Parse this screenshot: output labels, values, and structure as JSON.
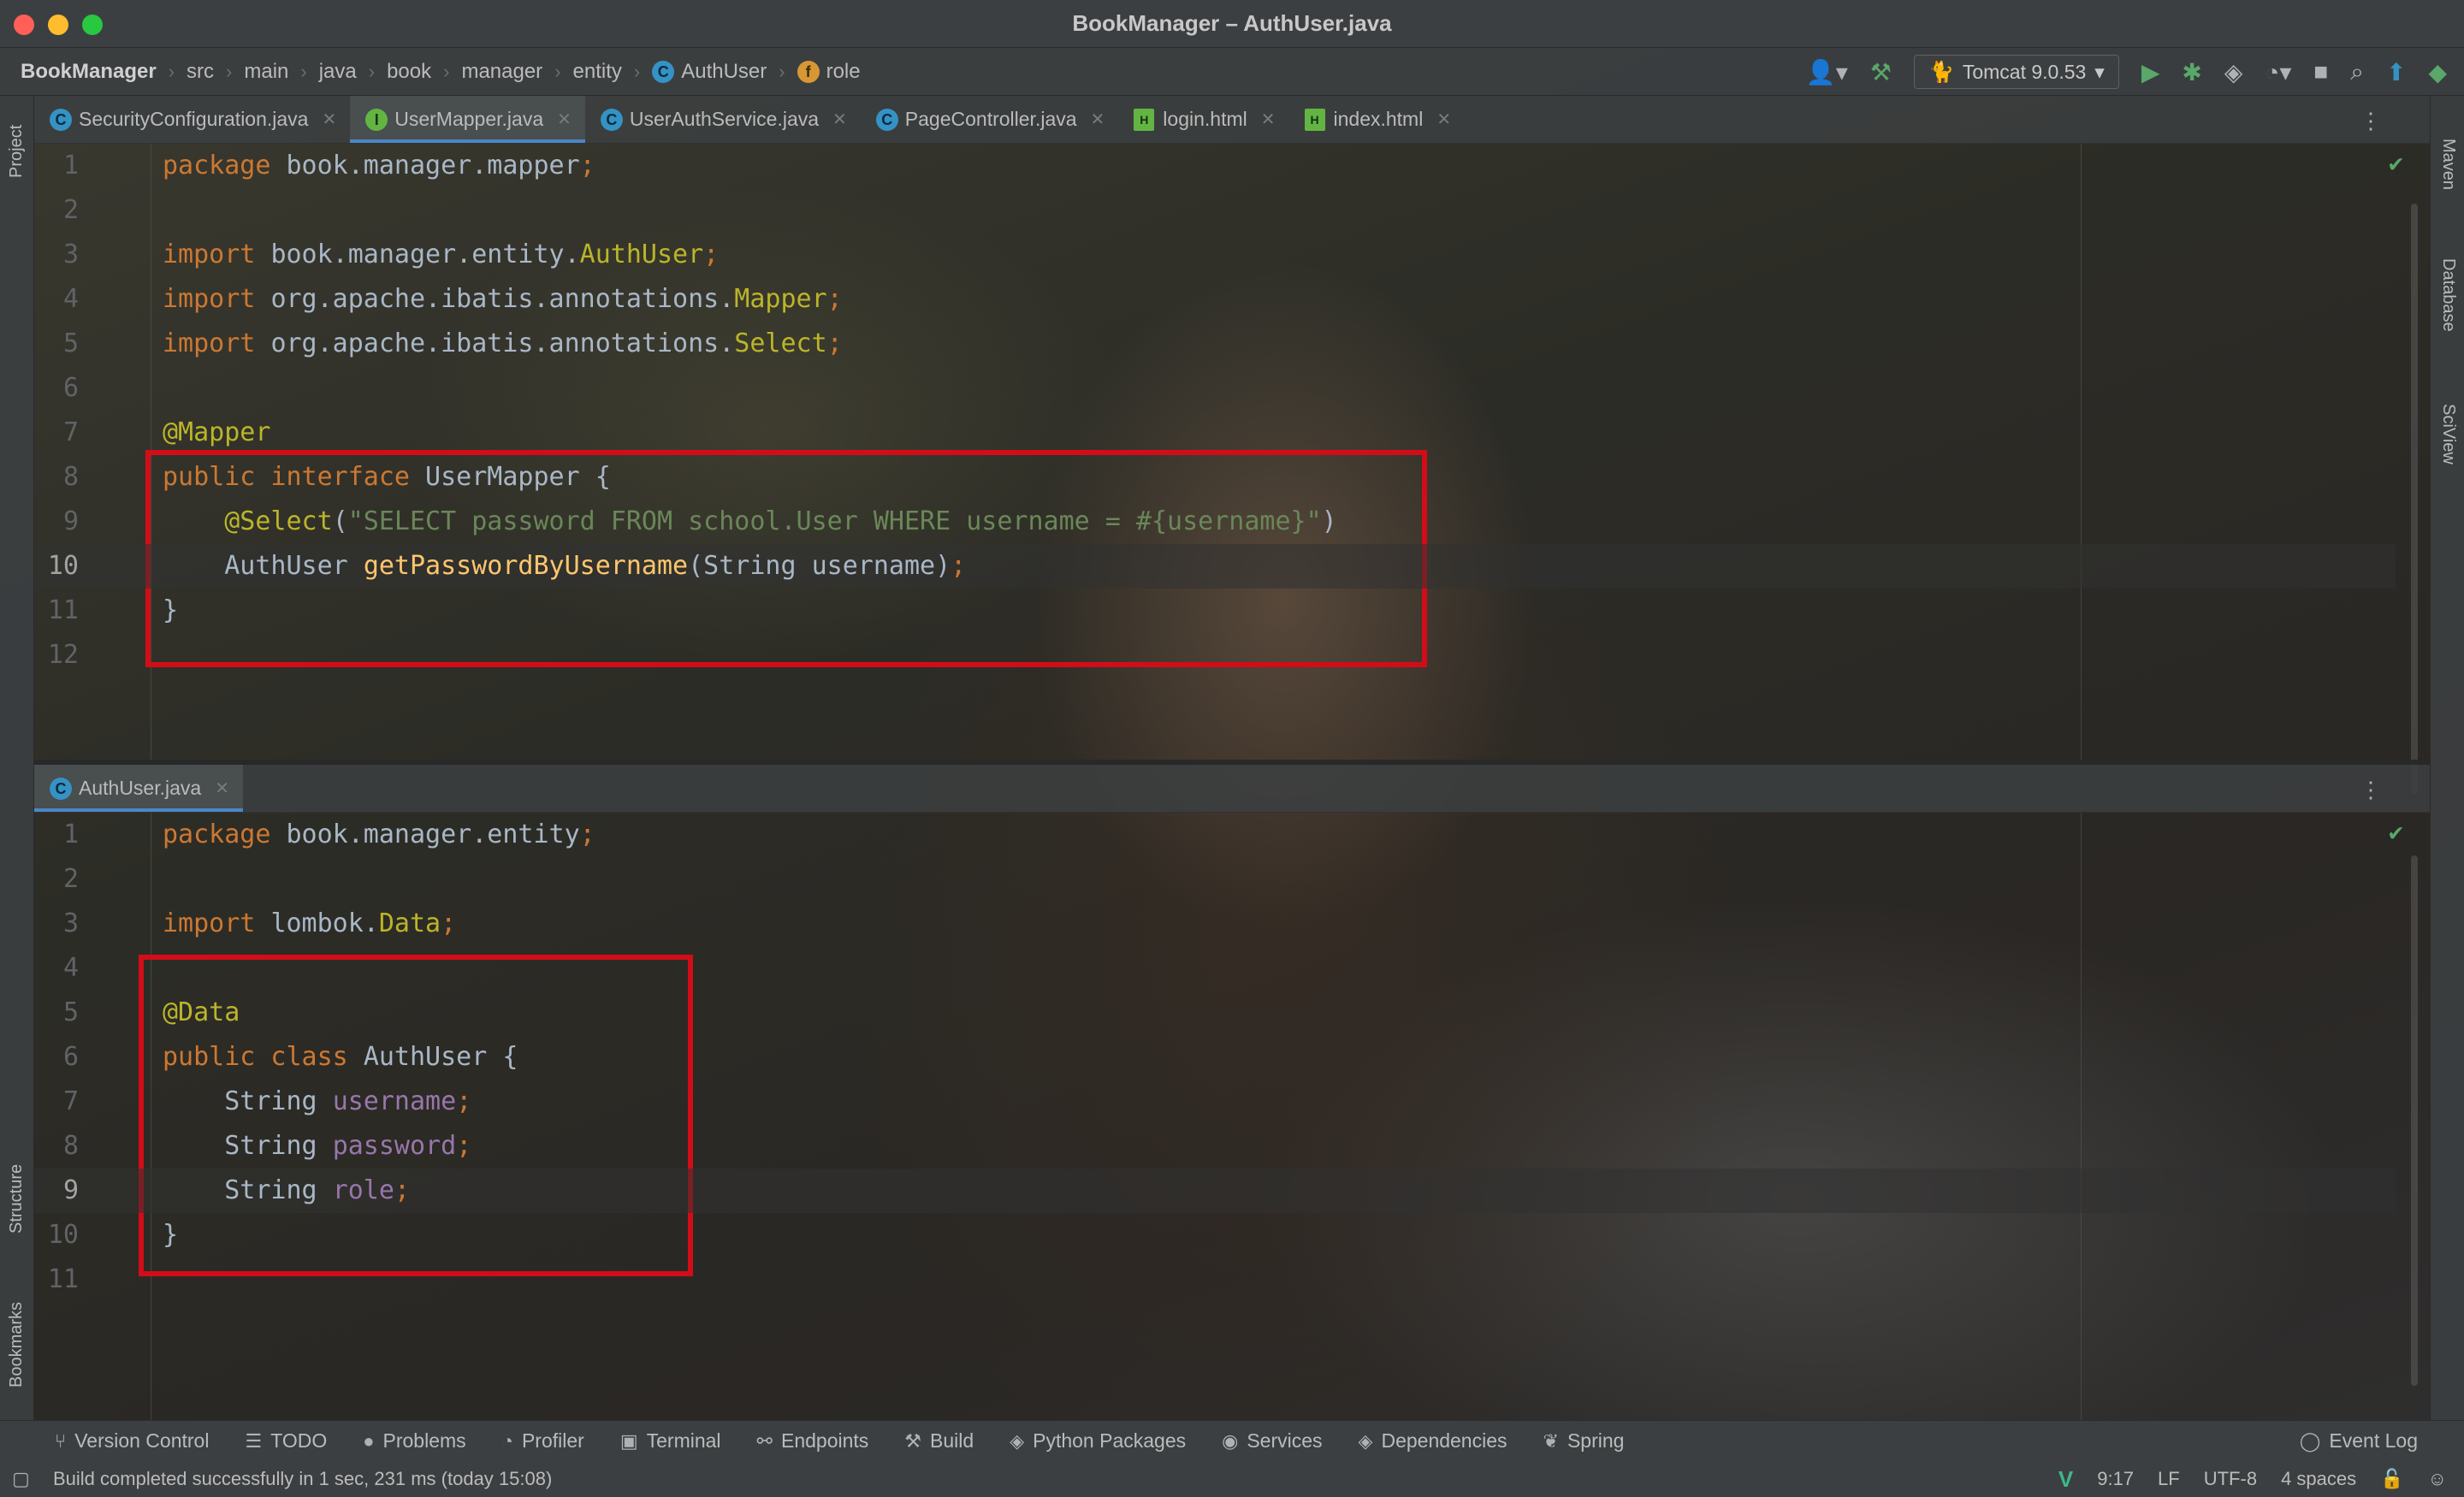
{
  "window": {
    "title": "BookManager – AuthUser.java"
  },
  "breadcrumb": [
    "BookManager",
    "src",
    "main",
    "java",
    "book",
    "manager",
    "entity",
    "AuthUser",
    "role"
  ],
  "toolbar": {
    "run_config": "Tomcat 9.0.53"
  },
  "left_panels": {
    "project": "Project",
    "structure": "Structure",
    "bookmarks": "Bookmarks"
  },
  "right_panels": {
    "maven": "Maven",
    "database": "Database",
    "sciview": "SciView"
  },
  "top_tabs": [
    {
      "label": "SecurityConfiguration.java",
      "icon": "class-icon"
    },
    {
      "label": "UserMapper.java",
      "icon": "interface-icon",
      "active": true
    },
    {
      "label": "UserAuthService.java",
      "icon": "class-icon"
    },
    {
      "label": "PageController.java",
      "icon": "class-icon"
    },
    {
      "label": "login.html",
      "icon": "html-file-icon"
    },
    {
      "label": "index.html",
      "icon": "html-file-icon"
    }
  ],
  "top_editor": {
    "current_line": "10",
    "lines": [
      {
        "num": "1",
        "tokens": [
          [
            "kw",
            "package "
          ],
          [
            "plain",
            "book.manager.mapper"
          ],
          [
            "kw",
            ";"
          ]
        ]
      },
      {
        "num": "2",
        "tokens": []
      },
      {
        "num": "3",
        "tokens": [
          [
            "kw",
            "import "
          ],
          [
            "plain",
            "book.manager.entity."
          ],
          [
            "ann",
            "AuthUser"
          ],
          [
            "kw",
            ";"
          ]
        ]
      },
      {
        "num": "4",
        "tokens": [
          [
            "kw",
            "import "
          ],
          [
            "plain",
            "org.apache.ibatis.annotations."
          ],
          [
            "ann",
            "Mapper"
          ],
          [
            "kw",
            ";"
          ]
        ]
      },
      {
        "num": "5",
        "tokens": [
          [
            "kw",
            "import "
          ],
          [
            "plain",
            "org.apache.ibatis.annotations."
          ],
          [
            "ann",
            "Select"
          ],
          [
            "kw",
            ";"
          ]
        ]
      },
      {
        "num": "6",
        "tokens": []
      },
      {
        "num": "7",
        "tokens": [
          [
            "ann",
            "@Mapper"
          ]
        ]
      },
      {
        "num": "8",
        "tokens": [
          [
            "kw",
            "public interface "
          ],
          [
            "plain",
            "UserMapper {"
          ]
        ]
      },
      {
        "num": "9",
        "tokens": [
          [
            "plain",
            "    "
          ],
          [
            "ann",
            "@Select"
          ],
          [
            "plain",
            "("
          ],
          [
            "str",
            "\"SELECT password FROM school.User WHERE username = #{username}\""
          ],
          [
            "plain",
            ")"
          ]
        ]
      },
      {
        "num": "10",
        "tokens": [
          [
            "plain",
            "    AuthUser "
          ],
          [
            "fn",
            "getPasswordByUsername"
          ],
          [
            "plain",
            "(String username)"
          ],
          [
            "kw",
            ";"
          ]
        ]
      },
      {
        "num": "11",
        "tokens": [
          [
            "plain",
            "}"
          ]
        ]
      },
      {
        "num": "12",
        "tokens": []
      }
    ]
  },
  "bottom_tab": {
    "label": "AuthUser.java"
  },
  "bottom_editor": {
    "current_line": "9",
    "lines": [
      {
        "num": "1",
        "tokens": [
          [
            "kw",
            "package "
          ],
          [
            "plain",
            "book.manager.entity"
          ],
          [
            "kw",
            ";"
          ]
        ]
      },
      {
        "num": "2",
        "tokens": []
      },
      {
        "num": "3",
        "tokens": [
          [
            "kw",
            "import "
          ],
          [
            "plain",
            "lombok."
          ],
          [
            "ann",
            "Data"
          ],
          [
            "kw",
            ";"
          ]
        ]
      },
      {
        "num": "4",
        "tokens": []
      },
      {
        "num": "5",
        "tokens": [
          [
            "ann",
            "@Data"
          ]
        ]
      },
      {
        "num": "6",
        "tokens": [
          [
            "kw",
            "public class "
          ],
          [
            "plain",
            "AuthUser {"
          ]
        ]
      },
      {
        "num": "7",
        "tokens": [
          [
            "plain",
            "    String "
          ],
          [
            "fld",
            "username"
          ],
          [
            "kw",
            ";"
          ]
        ]
      },
      {
        "num": "8",
        "tokens": [
          [
            "plain",
            "    String "
          ],
          [
            "fld",
            "password"
          ],
          [
            "kw",
            ";"
          ]
        ]
      },
      {
        "num": "9",
        "tokens": [
          [
            "plain",
            "    String "
          ],
          [
            "fld",
            "role"
          ],
          [
            "kw",
            ";"
          ]
        ]
      },
      {
        "num": "10",
        "tokens": [
          [
            "plain",
            "}"
          ]
        ]
      },
      {
        "num": "11",
        "tokens": []
      }
    ]
  },
  "tool_windows": [
    "Version Control",
    "TODO",
    "Problems",
    "Profiler",
    "Terminal",
    "Endpoints",
    "Build",
    "Python Packages",
    "Services",
    "Dependencies",
    "Spring"
  ],
  "event_log": "Event Log",
  "status": {
    "message": "Build completed successfully in 1 sec, 231 ms (today 15:08)",
    "position": "9:17",
    "line_sep": "LF",
    "encoding": "UTF-8",
    "indent": "4 spaces"
  },
  "colors": {
    "keyword": "#cc7832",
    "annotation": "#bbb529",
    "string": "#6a8759",
    "field": "#9876aa",
    "method": "#ffc66d",
    "highlight_box": "#d20d18"
  }
}
